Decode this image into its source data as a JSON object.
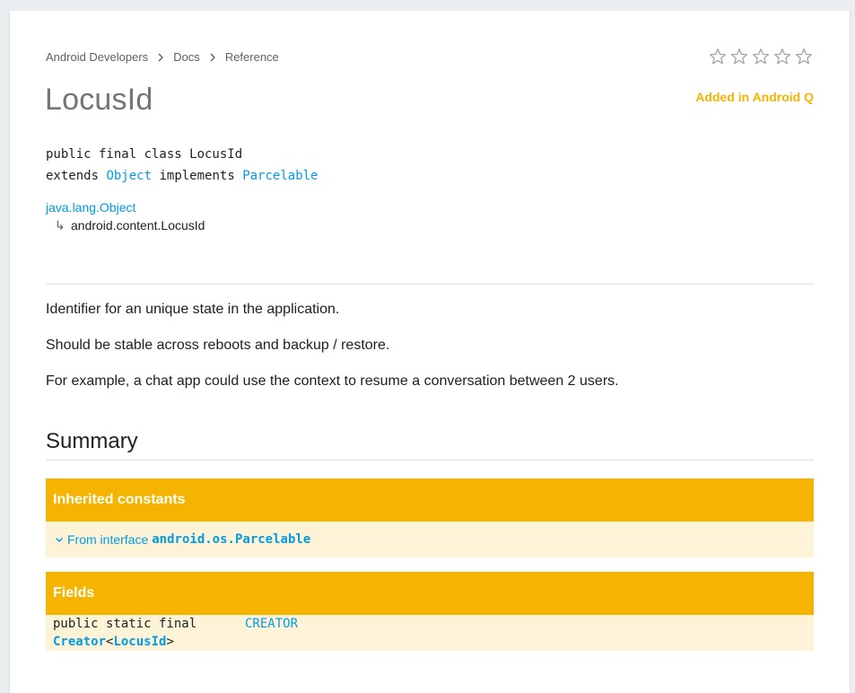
{
  "breadcrumb": {
    "items": [
      "Android Developers",
      "Docs",
      "Reference"
    ]
  },
  "rating": {
    "stars": 5,
    "filled": 0
  },
  "page": {
    "title": "LocusId",
    "added_in": "Added in Android Q"
  },
  "declaration": {
    "line1": "public final class LocusId",
    "extends_kw": "extends",
    "extends_class": "Object",
    "implements_kw": "implements",
    "implements_interface": "Parcelable"
  },
  "hierarchy": {
    "parent": "java.lang.Object",
    "arrow": "↳",
    "child": "android.content.LocusId"
  },
  "description": {
    "p1": "Identifier for an unique state in the application.",
    "p2": "Should be stable across reboots and backup / restore.",
    "p3": "For example, a chat app could use the context to resume a conversation between 2 users."
  },
  "summary": {
    "heading": "Summary",
    "inherited": {
      "header": "Inherited constants",
      "from_label": "From interface",
      "from_interface": "android.os.Parcelable"
    },
    "fields": {
      "header": "Fields",
      "modifiers": "public static final",
      "type_class": "Creator",
      "type_lt": "<",
      "type_param": "LocusId",
      "type_gt": ">",
      "name": "CREATOR"
    }
  },
  "colors": {
    "accent": "#f4b400",
    "link": "#039be5",
    "row_bg": "#fdf3d6"
  }
}
